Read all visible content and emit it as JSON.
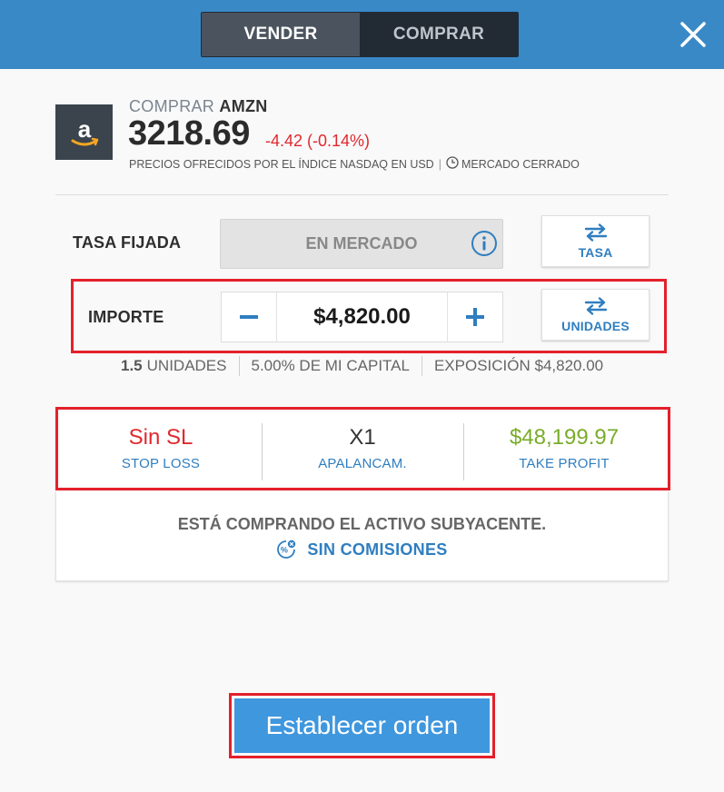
{
  "header": {
    "tabs": [
      {
        "label": "VENDER",
        "active": true
      },
      {
        "label": "COMPRAR",
        "active": false
      }
    ],
    "close_icon": "close-icon"
  },
  "instrument": {
    "action": "COMPRAR",
    "symbol": "AMZN",
    "logo_icon": "amazon-logo-icon",
    "price": "3218.69",
    "change": "-4.42 (-0.14%)",
    "price_note": "PRECIOS OFRECIDOS POR EL ÍNDICE NASDAQ EN USD",
    "separator": "|",
    "market_status": "MERCADO CERRADO"
  },
  "rate": {
    "label": "TASA FIJADA",
    "value": "EN MERCADO",
    "switch_label": "TASA"
  },
  "amount": {
    "label": "IMPORTE",
    "value": "$4,820.00",
    "switch_label": "UNIDADES"
  },
  "summary": {
    "units_value": "1.5",
    "units_label": "UNIDADES",
    "capital": "5.00% DE MI CAPITAL",
    "exposure": "EXPOSICIÓN $4,820.00"
  },
  "risk": {
    "stop_loss_value": "Sin SL",
    "stop_loss_label": "STOP LOSS",
    "leverage_value": "X1",
    "leverage_label": "APALANCAM.",
    "take_profit_value": "$48,199.97",
    "take_profit_label": "TAKE PROFIT"
  },
  "info": {
    "message": "ESTÁ COMPRANDO EL ACTIVO SUBYACENTE.",
    "no_commission": "SIN COMISIONES"
  },
  "order_button": "Establecer orden",
  "colors": {
    "header": "#3a89c7",
    "accent_blue": "#2f7ec0",
    "negative": "#e0292e",
    "positive": "#7aac2a",
    "highlight_frame": "#e3202b",
    "order_button": "#3f97de"
  }
}
